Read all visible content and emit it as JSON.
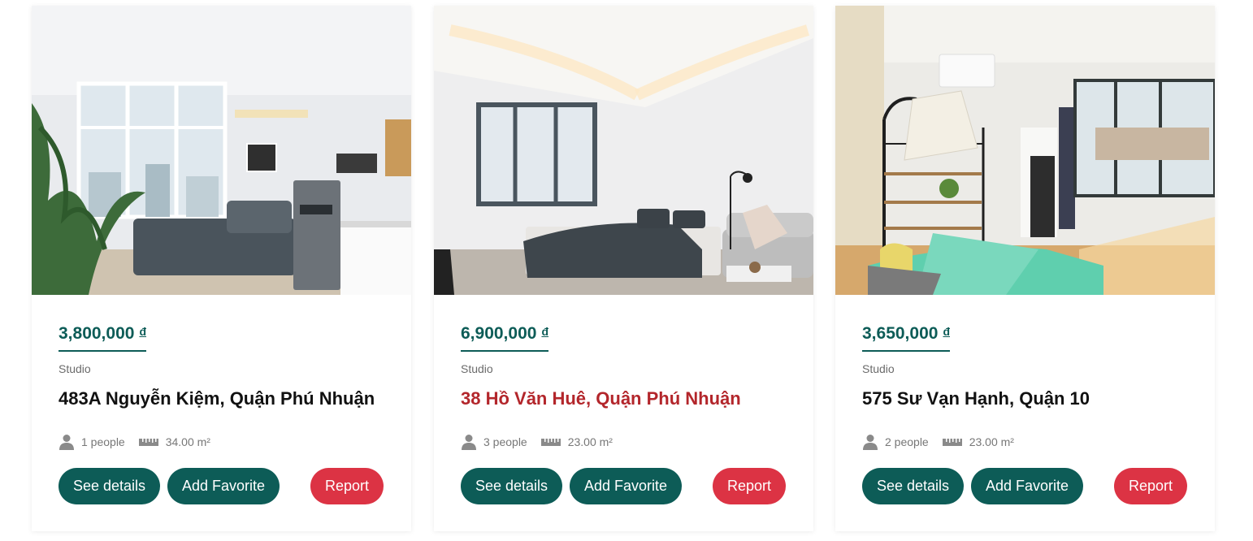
{
  "listings": [
    {
      "price": "3,800,000",
      "currency": "đ",
      "type": "Studio",
      "address": "483A Nguyễn Kiệm, Quận Phú Nhuận",
      "people": "1 people",
      "area": "34.00 m²",
      "highlighted": false,
      "photo_alt": "Studio room with large windows, grey sofa bed, fridge and kitchenette"
    },
    {
      "price": "6,900,000",
      "currency": "đ",
      "type": "Studio",
      "address": "38 Hồ Văn Huê, Quận Phú Nhuận",
      "people": "3 people",
      "area": "23.00 m²",
      "highlighted": true,
      "photo_alt": "Bright bedroom with dark grey bedding, floor lamp and sofa"
    },
    {
      "price": "3,650,000",
      "currency": "đ",
      "type": "Studio",
      "address": "575 Sư Vạn Hạnh, Quận 10",
      "people": "2 people",
      "area": "23.00 m²",
      "highlighted": false,
      "photo_alt": "Room with mint green bed, pleated lamp, shelf and window"
    }
  ],
  "buttons": {
    "details": "See details",
    "favorite": "Add Favorite",
    "report": "Report"
  },
  "icons": {
    "people": "person-icon",
    "area": "ruler-icon"
  },
  "colors": {
    "primary": "#0d5c57",
    "danger": "#dc3344",
    "highlight_address": "#b3262b"
  }
}
